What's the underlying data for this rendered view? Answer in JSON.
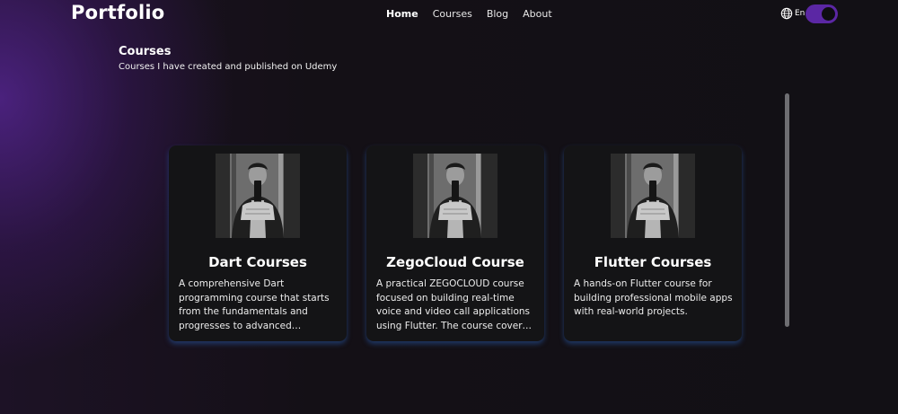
{
  "header": {
    "brand": "Portfolio",
    "nav": [
      "Home",
      "Courses",
      "Blog",
      "About"
    ],
    "active_nav": "Home",
    "language_label": "En",
    "language_icon": "globe-icon",
    "theme_toggle": "on",
    "accent_color": "#5b27a4"
  },
  "section": {
    "title": "Courses",
    "subtitle": "Courses I have created and published on Udemy"
  },
  "courses": [
    {
      "title": "Dart Courses",
      "description": "A comprehensive Dart programming course that starts from the fundamentals and progresses to advanced concepts. This course teaches you to write clean, efficient code."
    },
    {
      "title": "ZegoCloud Course",
      "description": "A practical ZEGOCLOUD course focused on building real-time voice and video call applications using Flutter. The course covers ZEGOCLOUD SDK integration step by step."
    },
    {
      "title": "Flutter Courses",
      "description": "A hands-on Flutter course for building professional mobile apps with real-world projects."
    }
  ]
}
